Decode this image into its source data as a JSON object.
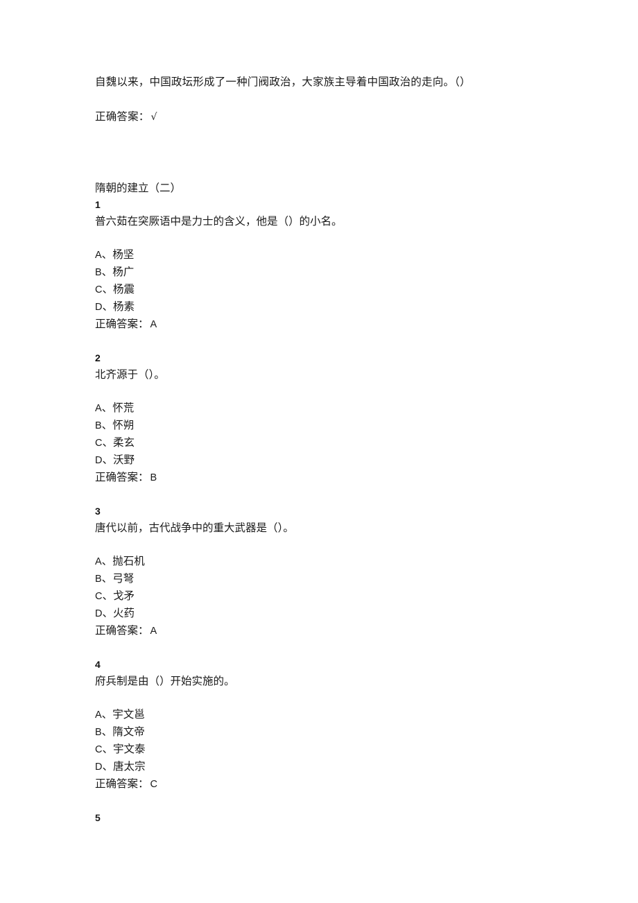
{
  "document": {
    "background_color": "#ffffff",
    "text_color": "#1a1a1a"
  },
  "top_item": {
    "stem": "自魏以来，中国政坛形成了一种门阀政治，大家族主导着中国政治的走向。（）",
    "answer_label": "正确答案：",
    "answer_value": "√"
  },
  "section": {
    "title": "隋朝的建立（二）",
    "questions": [
      {
        "number": "1",
        "stem": "普六茹在突厥语中是力士的含义，他是（）的小名。",
        "options": [
          {
            "letter": "A",
            "sep": "、",
            "text": "杨坚"
          },
          {
            "letter": "B",
            "sep": "、",
            "text": "杨广"
          },
          {
            "letter": "C",
            "sep": "、",
            "text": "杨震"
          },
          {
            "letter": "D",
            "sep": "、",
            "text": "杨素"
          }
        ],
        "answer_label": "正确答案：",
        "answer_value": "A"
      },
      {
        "number": "2",
        "stem": "北齐源于（）。",
        "options": [
          {
            "letter": "A",
            "sep": "、",
            "text": "怀荒"
          },
          {
            "letter": "B",
            "sep": "、",
            "text": "怀朔"
          },
          {
            "letter": "C",
            "sep": "、",
            "text": "柔玄"
          },
          {
            "letter": "D",
            "sep": "、",
            "text": "沃野"
          }
        ],
        "answer_label": "正确答案：",
        "answer_value": "B"
      },
      {
        "number": "3",
        "stem": "唐代以前，古代战争中的重大武器是（）。",
        "options": [
          {
            "letter": "A",
            "sep": "、",
            "text": "抛石机"
          },
          {
            "letter": "B",
            "sep": "、",
            "text": "弓弩"
          },
          {
            "letter": "C",
            "sep": "、",
            "text": "戈矛"
          },
          {
            "letter": "D",
            "sep": "、",
            "text": "火药"
          }
        ],
        "answer_label": "正确答案：",
        "answer_value": "A"
      },
      {
        "number": "4",
        "stem": "府兵制是由（）开始实施的。",
        "options": [
          {
            "letter": "A",
            "sep": "、",
            "text": "宇文邕"
          },
          {
            "letter": "B",
            "sep": "、",
            "text": "隋文帝"
          },
          {
            "letter": "C",
            "sep": "、",
            "text": "宇文泰"
          },
          {
            "letter": "D",
            "sep": "、",
            "text": "唐太宗"
          }
        ],
        "answer_label": "正确答案：",
        "answer_value": "C"
      }
    ],
    "next_question_number": "5"
  }
}
